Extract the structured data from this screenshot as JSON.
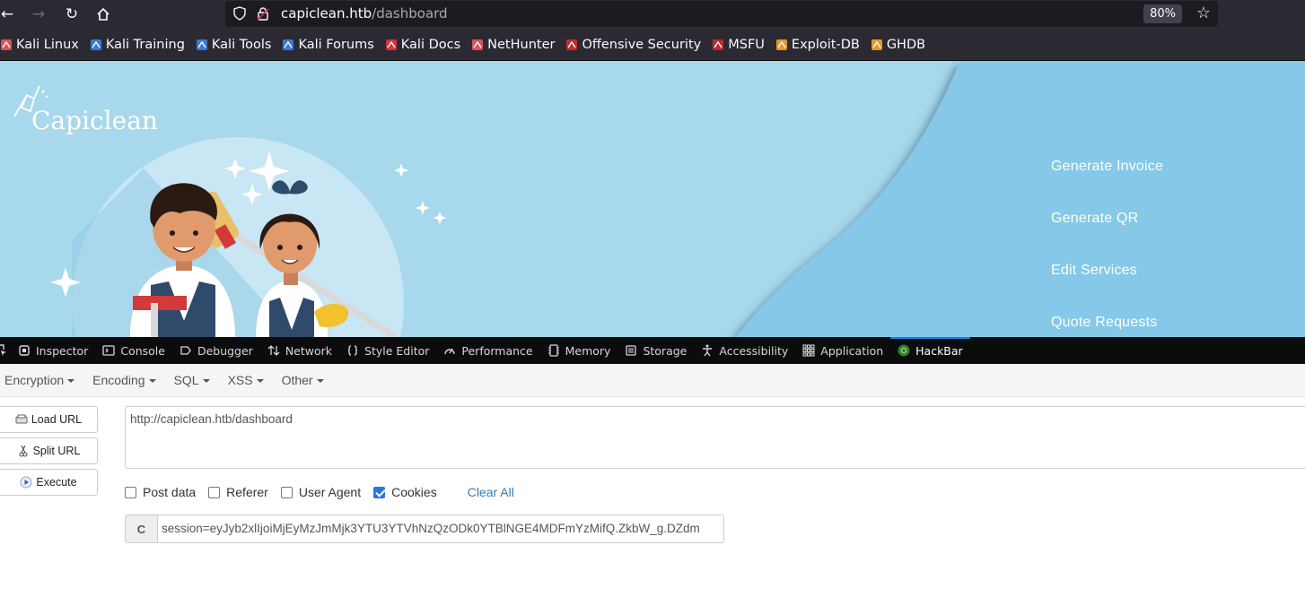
{
  "browser": {
    "url_host": "capiclean.htb",
    "url_path": "/dashboard",
    "zoom": "80%",
    "icons": {
      "back": "back-arrow-icon",
      "forward": "forward-arrow-icon",
      "reload": "reload-icon",
      "home": "home-icon",
      "shield": "shield-icon",
      "lock": "lock-icon",
      "star": "star-icon"
    }
  },
  "bookmarks": [
    {
      "label": "Kali Linux",
      "icon": "kali-icon",
      "color": "#e0505a"
    },
    {
      "label": "Kali Training",
      "icon": "kali-training-icon",
      "color": "#3a79d9"
    },
    {
      "label": "Kali Tools",
      "icon": "kali-tools-icon",
      "color": "#3a79d9"
    },
    {
      "label": "Kali Forums",
      "icon": "kali-forums-icon",
      "color": "#3a79d9"
    },
    {
      "label": "Kali Docs",
      "icon": "kali-docs-icon",
      "color": "#d9313a"
    },
    {
      "label": "NetHunter",
      "icon": "nethunter-icon",
      "color": "#e0505a"
    },
    {
      "label": "Offensive Security",
      "icon": "offsec-icon",
      "color": "#c8282c"
    },
    {
      "label": "MSFU",
      "icon": "msfu-icon",
      "color": "#c8282c"
    },
    {
      "label": "Exploit-DB",
      "icon": "exploitdb-icon",
      "color": "#e9962a"
    },
    {
      "label": "GHDB",
      "icon": "ghdb-icon",
      "color": "#e9962a"
    }
  ],
  "site": {
    "logo": "Capiclean",
    "nav": [
      "Generate Invoice",
      "Generate QR",
      "Edit Services",
      "Quote Requests"
    ],
    "colors": {
      "bg": "#a8d8ec",
      "panel": "#86c8e8"
    }
  },
  "devtools": {
    "tabs": [
      {
        "label": "Inspector",
        "icon": "inspector-icon"
      },
      {
        "label": "Console",
        "icon": "console-icon"
      },
      {
        "label": "Debugger",
        "icon": "debugger-icon"
      },
      {
        "label": "Network",
        "icon": "network-icon"
      },
      {
        "label": "Style Editor",
        "icon": "style-editor-icon"
      },
      {
        "label": "Performance",
        "icon": "performance-icon"
      },
      {
        "label": "Memory",
        "icon": "memory-icon"
      },
      {
        "label": "Storage",
        "icon": "storage-icon"
      },
      {
        "label": "Accessibility",
        "icon": "accessibility-icon"
      },
      {
        "label": "Application",
        "icon": "application-icon"
      },
      {
        "label": "HackBar",
        "icon": "hackbar-icon",
        "active": true
      }
    ]
  },
  "hackbar": {
    "menu": [
      "Encryption",
      "Encoding",
      "SQL",
      "XSS",
      "Other"
    ],
    "buttons": {
      "load": "Load URL",
      "split": "Split URL",
      "execute": "Execute"
    },
    "url": "http://capiclean.htb/dashboard",
    "checks": [
      {
        "label": "Post data",
        "checked": false
      },
      {
        "label": "Referer",
        "checked": false
      },
      {
        "label": "User Agent",
        "checked": false
      },
      {
        "label": "Cookies",
        "checked": true
      }
    ],
    "clear_all": "Clear All",
    "cookie_prefix": "C",
    "cookie_value": "session=eyJyb2xlIjoiMjEyMzJmMjk3YTU3YTVhNzQzODk0YTBlNGE4MDFmYzMifQ.ZkbW_g.DZdm"
  }
}
